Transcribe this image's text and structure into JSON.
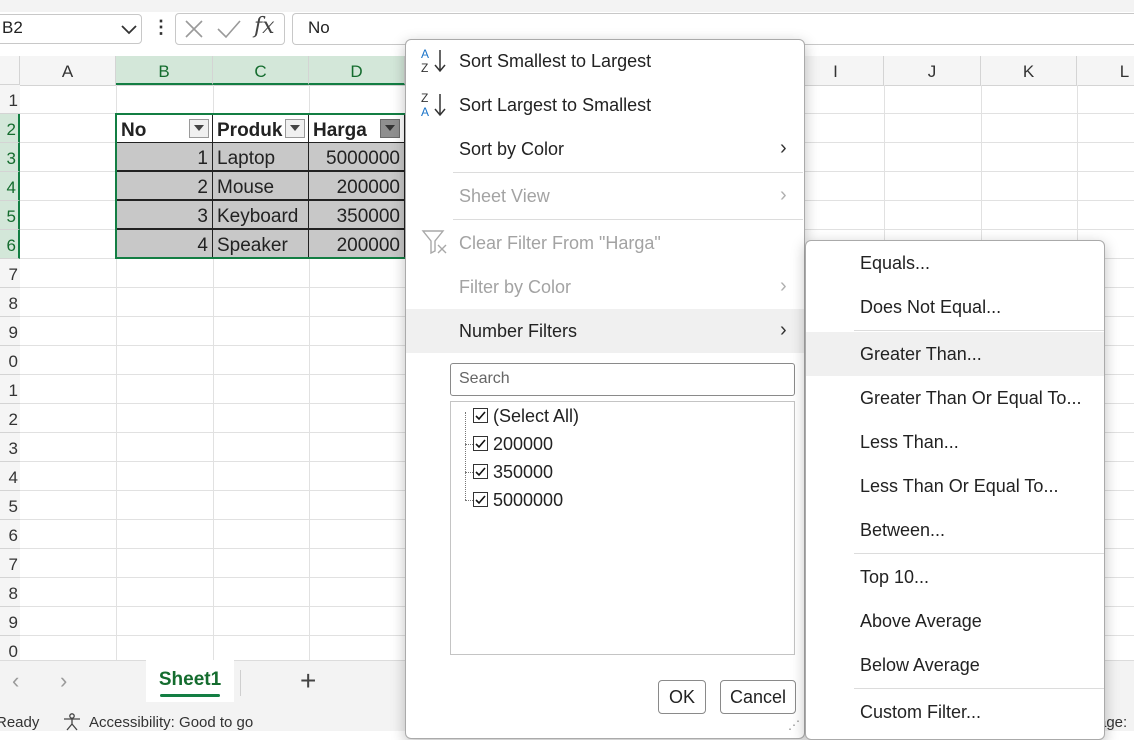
{
  "formula_bar": {
    "name_box": "B2",
    "formula": "No"
  },
  "columns": [
    "A",
    "B",
    "C",
    "D",
    "",
    "",
    "",
    "",
    "I",
    "J",
    "K",
    "L"
  ],
  "rows": [
    "1",
    "2",
    "3",
    "4",
    "5",
    "6",
    "7",
    "8",
    "9",
    "0",
    "1",
    "2",
    "3",
    "4",
    "5",
    "6",
    "7",
    "8",
    "9",
    "0"
  ],
  "table": {
    "headers": [
      "No",
      "Produk",
      "Harga"
    ],
    "rows": [
      [
        "1",
        "Laptop",
        "5000000"
      ],
      [
        "2",
        "Mouse",
        "200000"
      ],
      [
        "3",
        "Keyboard",
        "350000"
      ],
      [
        "4",
        "Speaker",
        "200000"
      ]
    ]
  },
  "sheet_bar": {
    "active_sheet": "Sheet1",
    "add_sheet": "+"
  },
  "status_bar": {
    "ready": "Ready",
    "accessibility": "Accessibility: Good to go",
    "page": "age:"
  },
  "filter_menu": {
    "sort_smallest": "Sort Smallest to Largest",
    "sort_largest": "Sort Largest to Smallest",
    "sort_by_color": "Sort by Color",
    "sheet_view": "Sheet View",
    "clear_filter": "Clear Filter From \"Harga\"",
    "filter_by_color": "Filter by Color",
    "number_filters": "Number Filters",
    "search_placeholder": "Search",
    "values": [
      "(Select All)",
      "200000",
      "350000",
      "5000000"
    ],
    "ok": "OK",
    "cancel": "Cancel"
  },
  "number_filters_submenu": {
    "items": [
      "Equals...",
      "Does Not Equal...",
      "Greater Than...",
      "Greater Than Or Equal To...",
      "Less Than...",
      "Less Than Or Equal To...",
      "Between...",
      "Top 10...",
      "Above Average",
      "Below Average",
      "Custom Filter..."
    ]
  },
  "colors": {
    "accent_green": "#137e43",
    "selected_header_bg": "#d3e7d9",
    "table_fill": "#c8c8c8",
    "sort_icon_blue": "#1a73c8"
  }
}
